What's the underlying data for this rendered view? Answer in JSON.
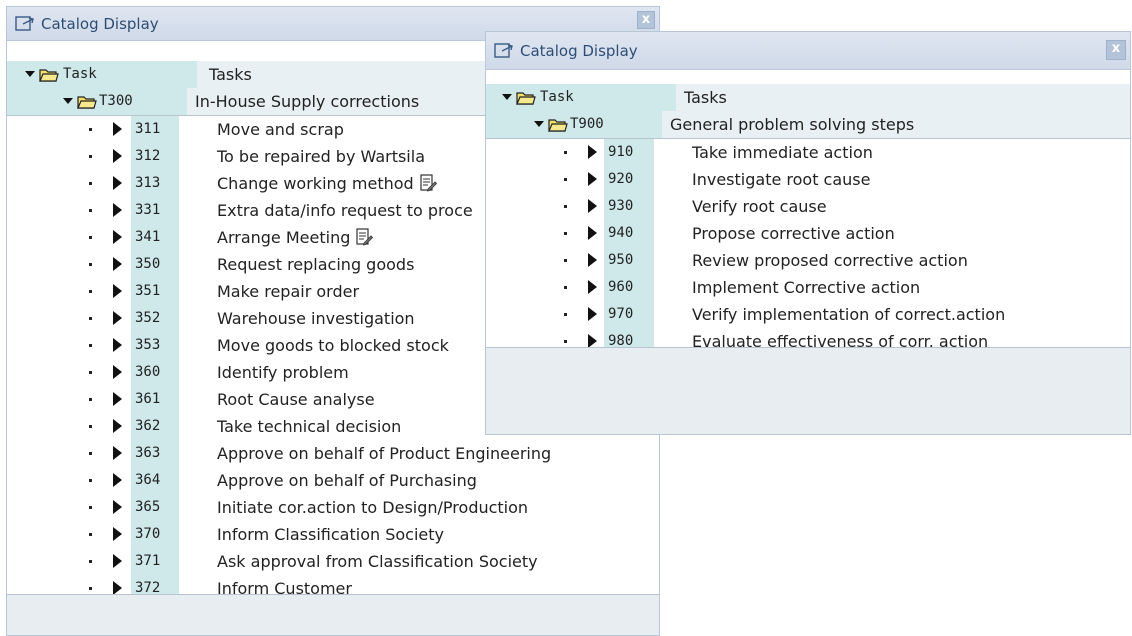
{
  "window1": {
    "title": "Catalog Display",
    "close_label": "x",
    "header": {
      "code": "Task",
      "text": "Tasks"
    },
    "group": {
      "code": "T300",
      "text": "In-House Supply corrections"
    },
    "items": [
      {
        "code": "311",
        "text": "Move and scrap",
        "icon": ""
      },
      {
        "code": "312",
        "text": "To be repaired by Wartsila",
        "icon": ""
      },
      {
        "code": "313",
        "text": "Change working method",
        "icon": "note-edit-icon"
      },
      {
        "code": "331",
        "text": "Extra data/info request to proce",
        "icon": ""
      },
      {
        "code": "341",
        "text": "Arrange Meeting",
        "icon": "note-edit-icon"
      },
      {
        "code": "350",
        "text": "Request replacing goods",
        "icon": ""
      },
      {
        "code": "351",
        "text": "Make repair order",
        "icon": ""
      },
      {
        "code": "352",
        "text": "Warehouse investigation",
        "icon": ""
      },
      {
        "code": "353",
        "text": "Move goods to blocked stock",
        "icon": ""
      },
      {
        "code": "360",
        "text": "Identify problem",
        "icon": ""
      },
      {
        "code": "361",
        "text": "Root Cause analyse",
        "icon": ""
      },
      {
        "code": "362",
        "text": "Take technical decision",
        "icon": ""
      },
      {
        "code": "363",
        "text": "Approve on behalf of Product Engineering",
        "icon": ""
      },
      {
        "code": "364",
        "text": "Approve on behalf of Purchasing",
        "icon": ""
      },
      {
        "code": "365",
        "text": "Initiate cor.action to Design/Production",
        "icon": ""
      },
      {
        "code": "370",
        "text": "Inform Classification Society",
        "icon": ""
      },
      {
        "code": "371",
        "text": "Ask approval from Classification Society",
        "icon": ""
      },
      {
        "code": "372",
        "text": "Inform Customer",
        "icon": ""
      }
    ]
  },
  "window2": {
    "title": "Catalog Display",
    "close_label": "x",
    "header": {
      "code": "Task",
      "text": "Tasks"
    },
    "group": {
      "code": "T900",
      "text": "General problem solving steps"
    },
    "items": [
      {
        "code": "910",
        "text": "Take immediate action"
      },
      {
        "code": "920",
        "text": "Investigate root cause"
      },
      {
        "code": "930",
        "text": "Verify root cause"
      },
      {
        "code": "940",
        "text": "Propose corrective action"
      },
      {
        "code": "950",
        "text": "Review proposed corrective action"
      },
      {
        "code": "960",
        "text": "Implement Corrective action"
      },
      {
        "code": "970",
        "text": "Verify implementation of correct.action"
      },
      {
        "code": "980",
        "text": "Evaluate effectiveness of corr. action"
      }
    ]
  },
  "colors": {
    "title_text": "#2f4d74",
    "code_column_bg": "#cfe9ea",
    "titlebar_bg": "#d6dfec",
    "footer_bg": "#e8edf2"
  }
}
